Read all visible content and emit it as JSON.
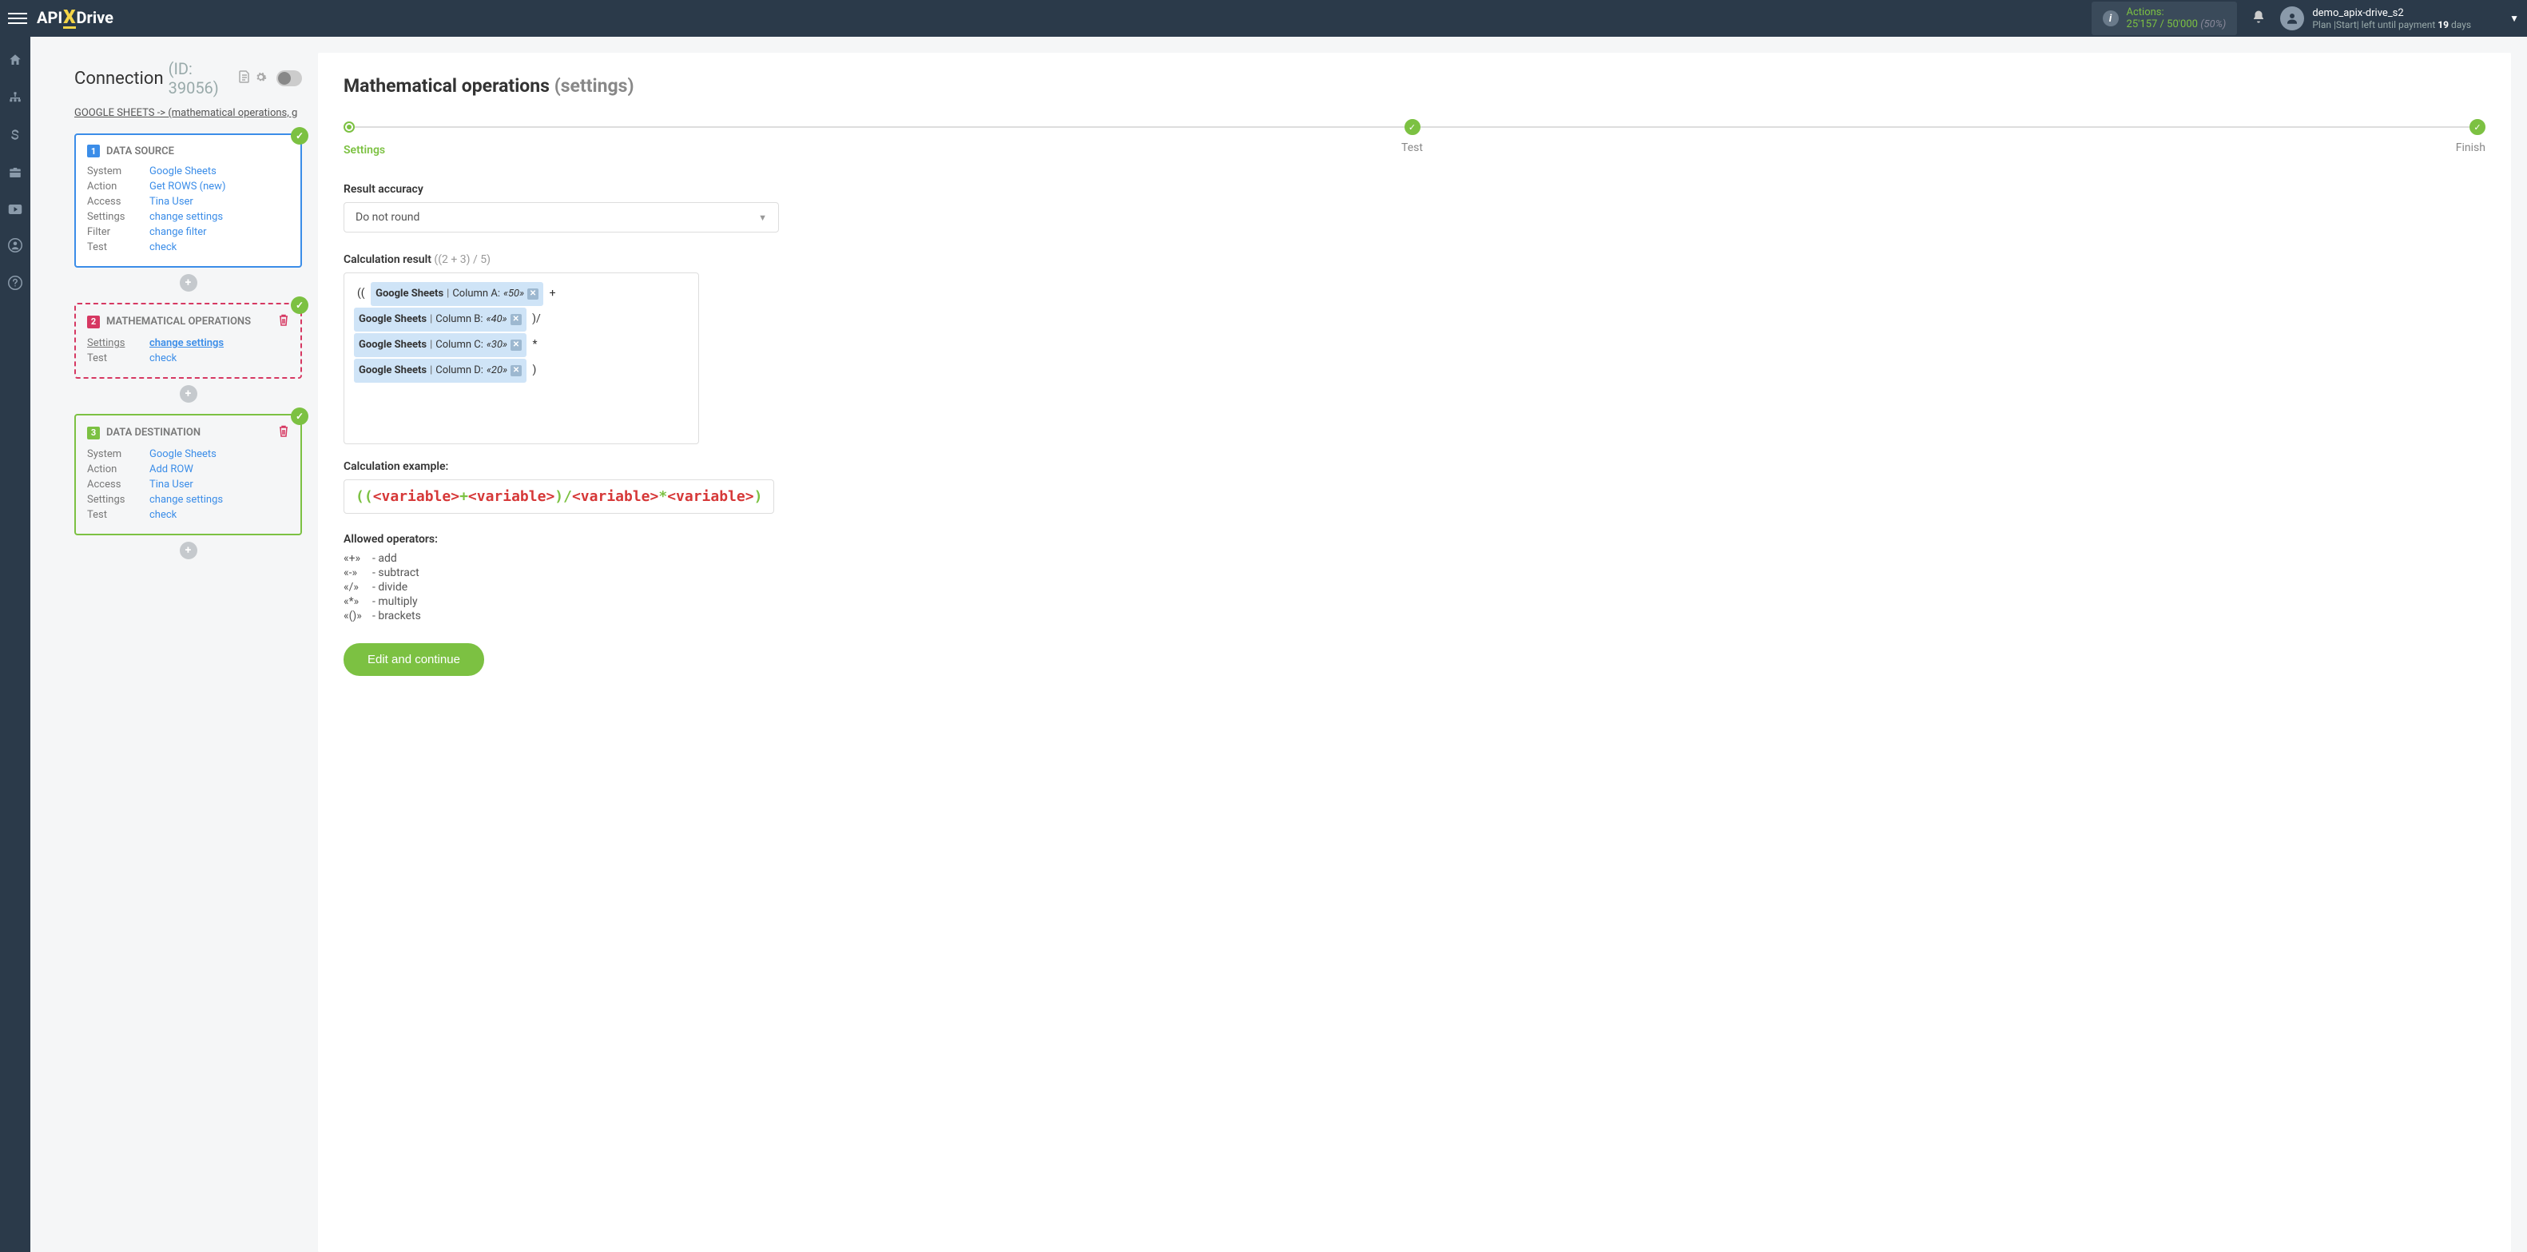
{
  "header": {
    "logo_prefix": "API",
    "logo_suffix": "Drive",
    "actions": {
      "title": "Actions:",
      "used": "25'157",
      "sep": " / ",
      "total": "50'000",
      "pct": "(50%)"
    },
    "user": {
      "name": "demo_apix-drive_s2",
      "plan_prefix": "Plan |Start| left until payment ",
      "days": "19",
      "plan_suffix": " days"
    }
  },
  "left": {
    "title": "Connection",
    "id_label": "(ID: 39056)",
    "breadcrumb": "GOOGLE SHEETS -> (mathematical operations, g",
    "source": {
      "num": "1",
      "title": "DATA SOURCE",
      "rows": {
        "system_l": "System",
        "system_v": "Google Sheets",
        "action_l": "Action",
        "action_v": "Get ROWS (new)",
        "access_l": "Access",
        "access_v": "Tina User",
        "settings_l": "Settings",
        "settings_v": "change settings",
        "filter_l": "Filter",
        "filter_v": "change filter",
        "test_l": "Test",
        "test_v": "check"
      }
    },
    "math": {
      "num": "2",
      "title": "MATHEMATICAL OPERATIONS",
      "rows": {
        "settings_l": "Settings",
        "settings_v": "change settings",
        "test_l": "Test",
        "test_v": "check"
      }
    },
    "dest": {
      "num": "3",
      "title": "DATA DESTINATION",
      "rows": {
        "system_l": "System",
        "system_v": "Google Sheets",
        "action_l": "Action",
        "action_v": "Add ROW",
        "access_l": "Access",
        "access_v": "Tina User",
        "settings_l": "Settings",
        "settings_v": "change settings",
        "test_l": "Test",
        "test_v": "check"
      }
    }
  },
  "main": {
    "title": "Mathematical operations",
    "subtitle": "(settings)",
    "steps": {
      "s1": "Settings",
      "s2": "Test",
      "s3": "Finish"
    },
    "accuracy": {
      "label": "Result accuracy",
      "value": "Do not round"
    },
    "calc": {
      "label": "Calculation result",
      "hint": "((2 + 3) / 5)",
      "tags": {
        "gs": "Google Sheets",
        "colA": "Column A:",
        "valA": "«50»",
        "colB": "Column B:",
        "valB": "«40»",
        "colC": "Column C:",
        "valC": "«30»",
        "colD": "Column D:",
        "valD": "«20»"
      },
      "ops": {
        "open2": "((",
        "plus": "+",
        "closeDiv": ")/",
        "mul": "*",
        "close": ")"
      }
    },
    "example": {
      "label": "Calculation example:",
      "var": "<variable>"
    },
    "operators": {
      "label": "Allowed operators:",
      "add_s": "«+»",
      "add_t": "- add",
      "sub_s": "«-»",
      "sub_t": "- subtract",
      "div_s": "«/»",
      "div_t": "- divide",
      "mul_s": "«*»",
      "mul_t": "- multiply",
      "brk_s": "«()»",
      "brk_t": "- brackets"
    },
    "button": "Edit and continue"
  }
}
